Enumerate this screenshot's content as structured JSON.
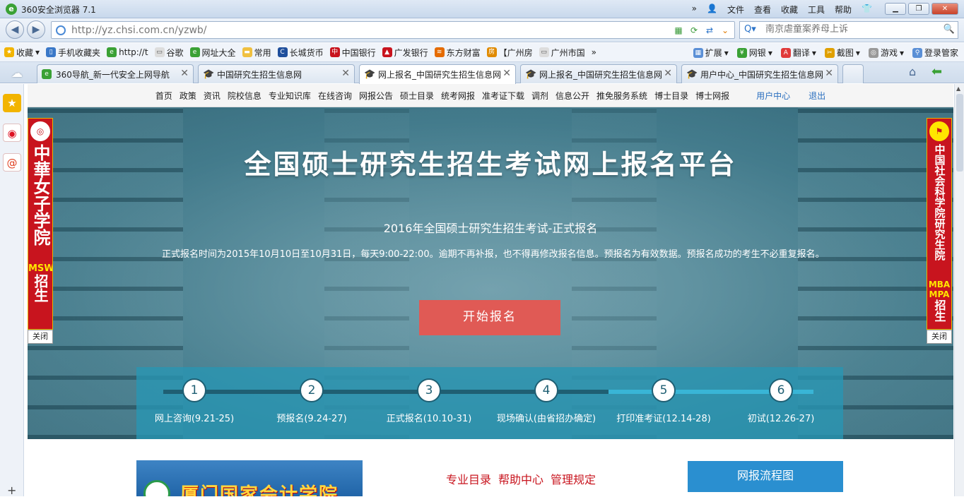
{
  "window": {
    "title": "360安全浏览器 7.1",
    "menu": [
      "文件",
      "查看",
      "收藏",
      "工具",
      "帮助"
    ]
  },
  "address": {
    "url": "http://yz.chsi.com.cn/yzwb/"
  },
  "search": {
    "placeholder": "南京虐童案养母上诉"
  },
  "favbar": {
    "items": [
      "收藏",
      "手机收藏夹",
      "http://t",
      "谷歌",
      "网址大全",
      "常用",
      "长城货币",
      "中国银行",
      "广发银行",
      "东方财富",
      "【广州房",
      "广州市国"
    ],
    "more": "»",
    "right": [
      "扩展",
      "网银",
      "翻译",
      "截图",
      "游戏",
      "登录管家"
    ]
  },
  "tabs": [
    {
      "label": "360导航_新一代安全上网导航"
    },
    {
      "label": "中国研究生招生信息网"
    },
    {
      "label": "网上报名_中国研究生招生信息网"
    },
    {
      "label": "网上报名_中国研究生招生信息网"
    },
    {
      "label": "用户中心_中国研究生招生信息网"
    }
  ],
  "topnav": {
    "items": [
      "首页",
      "政策",
      "资讯",
      "院校信息",
      "专业知识库",
      "在线咨询",
      "网报公告",
      "硕士目录",
      "统考网报",
      "准考证下载",
      "调剂",
      "信息公开",
      "推免服务系统",
      "博士目录",
      "博士网报"
    ],
    "user_center": "用户中心",
    "logout": "退出"
  },
  "hero": {
    "title": "全国硕士研究生招生考试网上报名平台",
    "subtitle": "2016年全国硕士研究生招生考试-正式报名",
    "notice": "正式报名时间为2015年10月10日至10月31日，每天9:00-22:00。逾期不再补报，也不得再修改报名信息。预报名为有效数据。预报名成功的考生不必重复报名。",
    "start_button": "开始报名"
  },
  "steps": [
    {
      "num": "1",
      "label": "网上咨询(9.21-25)"
    },
    {
      "num": "2",
      "label": "预报名(9.24-27)"
    },
    {
      "num": "3",
      "label": "正式报名(10.10-31)"
    },
    {
      "num": "4",
      "label": "现场确认(由省招办确定)"
    },
    {
      "num": "5",
      "label": "打印准考证(12.14-28)"
    },
    {
      "num": "6",
      "label": "初试(12.26-27)"
    }
  ],
  "bottom": {
    "banner_text": "厦门国家会计学院",
    "links": [
      "专业目录",
      "帮助中心",
      "管理规定"
    ],
    "flow_button": "网报流程图"
  },
  "ads": {
    "left": {
      "chars": "中華女子学院",
      "tag": "MSW",
      "tail": "招生",
      "close": "关闭"
    },
    "right": {
      "chars": "中国社会科学院研究生院",
      "tag": "MBA MPA",
      "tail": "招生",
      "close": "关闭"
    }
  }
}
